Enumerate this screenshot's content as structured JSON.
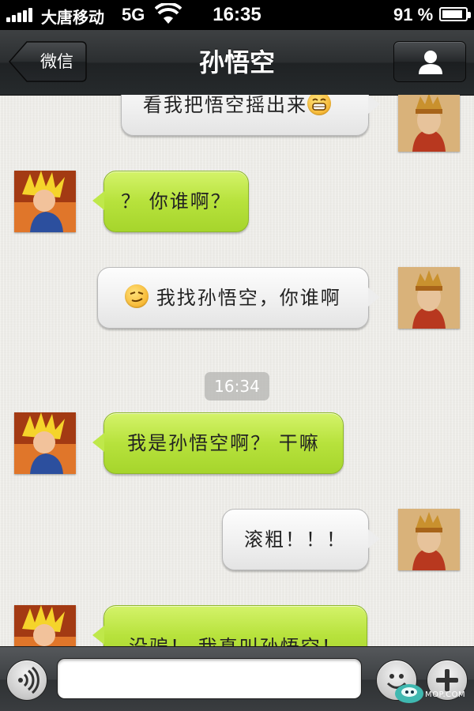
{
  "status_bar": {
    "carrier": "大唐移动",
    "network": "5G",
    "time": "16:35",
    "battery_percent": "91 %",
    "battery_level": 0.91
  },
  "nav": {
    "back_label": "微信",
    "title": "孙悟空",
    "profile_icon": "person-icon"
  },
  "messages": [
    {
      "side": "right",
      "text": "看我把悟空摇出来",
      "emoji": "grin-emoji"
    },
    {
      "side": "left",
      "text": "？ 你谁啊？"
    },
    {
      "side": "right",
      "text": "我找孙悟空，你谁啊",
      "emoji_before": "smirk-emoji"
    },
    {
      "timestamp": "16:34"
    },
    {
      "side": "left",
      "text": "我是孙悟空啊？ 干嘛"
    },
    {
      "side": "right",
      "text": "滚粗！！！"
    },
    {
      "side": "left",
      "text": "没骗！ 我真叫孙悟空！"
    }
  ],
  "input_bar": {
    "voice_icon": "voice-icon",
    "text_value": "",
    "emoji_icon": "smiley-icon",
    "plus_icon": "plus-icon"
  },
  "watermark": "MOP.COM",
  "colors": {
    "green_bubble": "#b7e23c",
    "gray_bubble": "#f0f0f0",
    "nav_bar": "#2b2e30"
  }
}
